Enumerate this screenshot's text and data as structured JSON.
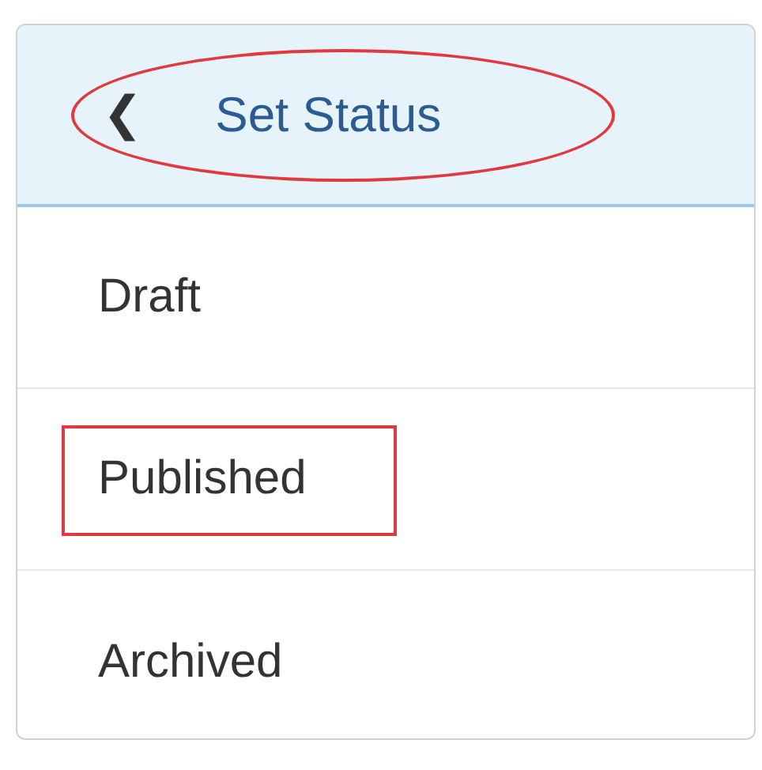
{
  "header": {
    "back_icon": "❮",
    "title": "Set Status",
    "annotated": true
  },
  "items": [
    {
      "label": "Draft",
      "annotated": false
    },
    {
      "label": "Published",
      "annotated": true
    },
    {
      "label": "Archived",
      "annotated": false
    }
  ]
}
